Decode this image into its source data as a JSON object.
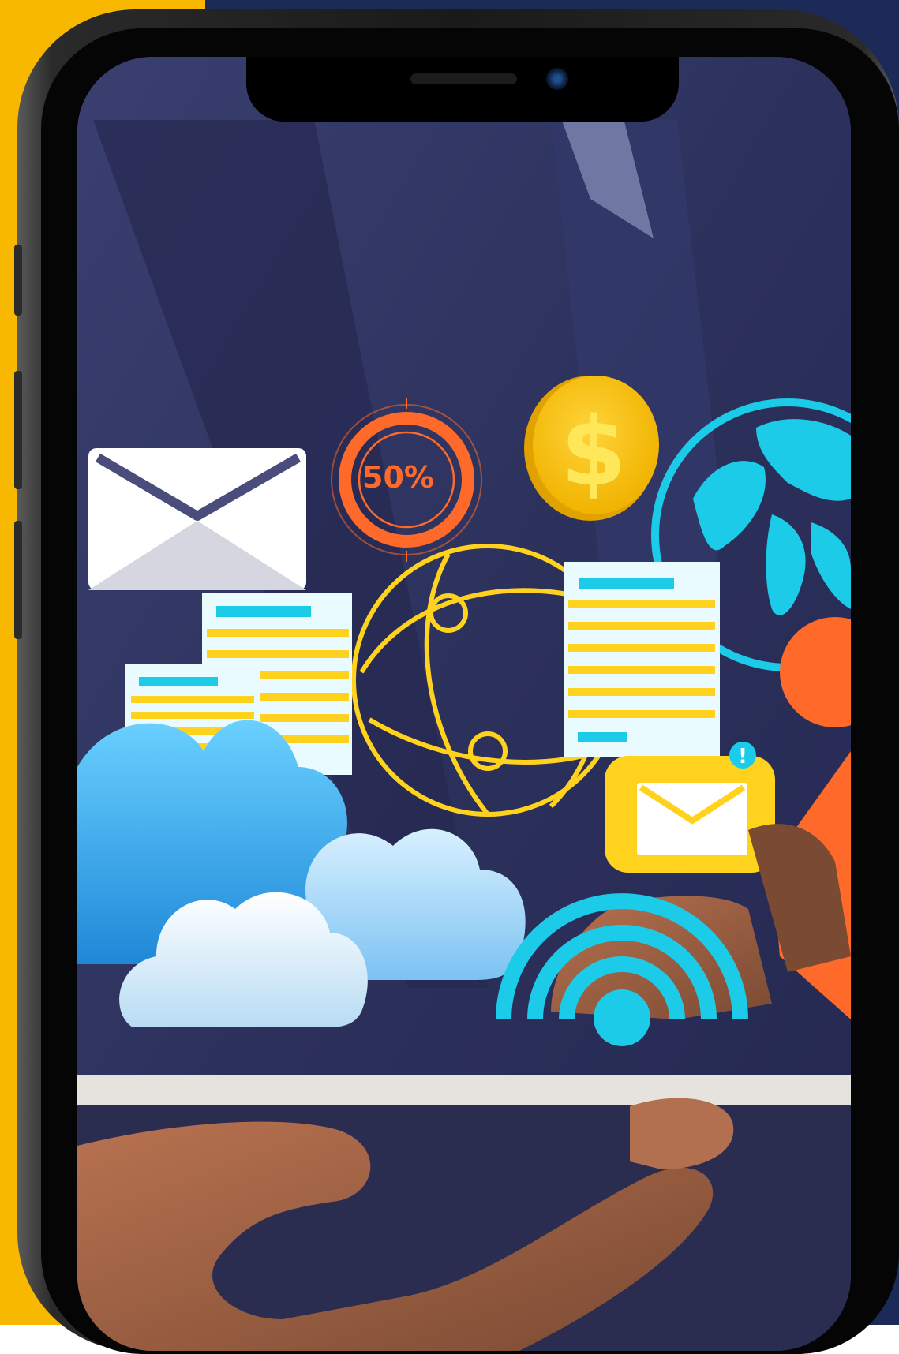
{
  "colors": {
    "left_panel": "#f9b800",
    "right_panel": "#1b2a57",
    "suit": "#2e3461",
    "accent_orange": "#ff6a2a",
    "accent_yellow": "#ffd21e",
    "accent_cyan": "#1ccbe8",
    "cloud_blue": "#5ab8ef",
    "skin": "#a8674a"
  },
  "hologram": {
    "progress_label": "50%",
    "progress_value": 50,
    "coin_symbol": "$",
    "alert_badge": "!"
  },
  "icons": [
    "envelope-icon",
    "progress-ring-icon",
    "dollar-coin-icon",
    "globe-icon",
    "network-sphere-icon",
    "document-icon",
    "cloud-icon",
    "mail-notification-icon",
    "wifi-signal-icon",
    "user-profile-icon"
  ]
}
